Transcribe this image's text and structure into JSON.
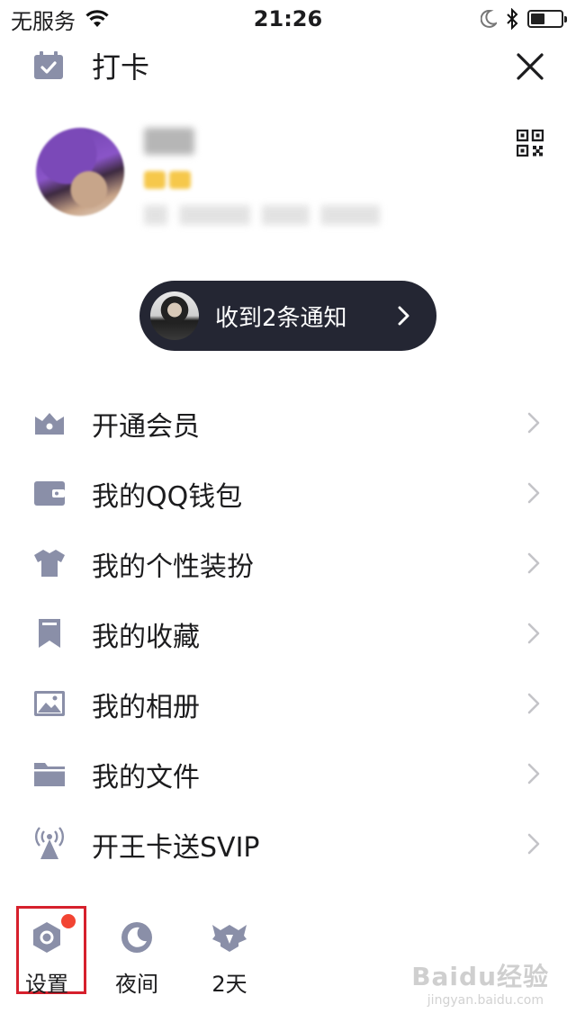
{
  "status_bar": {
    "carrier": "无服务",
    "time": "21:26"
  },
  "header": {
    "checkin_label": "打卡"
  },
  "notification": {
    "text": "收到2条通知"
  },
  "menu": [
    {
      "label": "开通会员",
      "icon": "crown-icon"
    },
    {
      "label": "我的QQ钱包",
      "icon": "wallet-icon"
    },
    {
      "label": "我的个性装扮",
      "icon": "shirt-icon"
    },
    {
      "label": "我的收藏",
      "icon": "bookmark-icon"
    },
    {
      "label": "我的相册",
      "icon": "photo-icon"
    },
    {
      "label": "我的文件",
      "icon": "folder-icon"
    },
    {
      "label": "开王卡送SVIP",
      "icon": "signal-tower-icon"
    }
  ],
  "bottom_bar": {
    "settings": "设置",
    "night": "夜间",
    "days": "2天"
  },
  "watermark": {
    "brand": "Baidu经验",
    "url": "jingyan.baidu.com"
  },
  "colors": {
    "icon_gray": "#8a8fa8",
    "pill_bg": "#242633",
    "badge_red": "#f24432",
    "highlight_red": "#d6202c"
  }
}
